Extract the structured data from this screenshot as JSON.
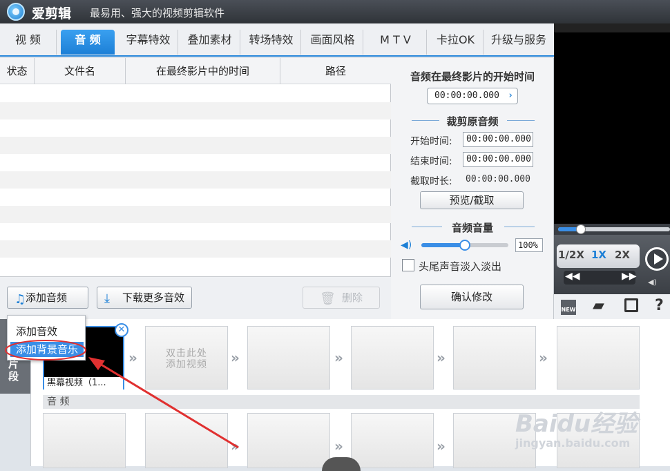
{
  "app": {
    "name": "爱剪辑",
    "slogan": "最易用、强大的视频剪辑软件"
  },
  "tabs": [
    {
      "label": "视 频"
    },
    {
      "label": "音 频"
    },
    {
      "label": "字幕特效"
    },
    {
      "label": "叠加素材"
    },
    {
      "label": "转场特效"
    },
    {
      "label": "画面风格"
    },
    {
      "label": "M T V"
    },
    {
      "label": "卡拉OK"
    },
    {
      "label": "升级与服务"
    }
  ],
  "list": {
    "columns": [
      "状态",
      "文件名",
      "在最终影片中的时间",
      "路径"
    ]
  },
  "panel": {
    "start_title": "音频在最终影片的开始时间",
    "start_time": "00:00:00.000",
    "trim_title": "裁剪原音频",
    "start_label": "开始时间:",
    "start_value": "00:00:00.000",
    "end_label": "结束时间:",
    "end_value": "00:00:00.000",
    "duration_label": "截取时长:",
    "duration_value": "00:00:00.000",
    "preview_button": "预览/截取",
    "volume_title": "音频音量",
    "volume_value": "100%",
    "volume_level": 0.5,
    "fade_label": "头尾声音淡入淡出",
    "confirm_button": "确认修改"
  },
  "toolbar": {
    "add_audio": "添加音频",
    "download_more": "下载更多音效",
    "delete": "删除"
  },
  "popup": {
    "items": [
      "添加音效",
      "添加背景音乐"
    ]
  },
  "player": {
    "speed_options": [
      "1/2X",
      "1X",
      "2X"
    ],
    "active_speed": "1X",
    "new_badge": "NEW"
  },
  "timeline": {
    "side_label": "片段",
    "clip1_label": "黑幕视频（1...",
    "add_hint_1": "双击此处",
    "add_hint_2": "添加视频",
    "audio_label": "音 频"
  },
  "watermark": {
    "brand": "Baidu经验",
    "url": "jingyan.baidu.com"
  },
  "colors": {
    "accent": "#1c7fd6",
    "highlight": "#3a8ee6",
    "annotation": "#e03030"
  }
}
